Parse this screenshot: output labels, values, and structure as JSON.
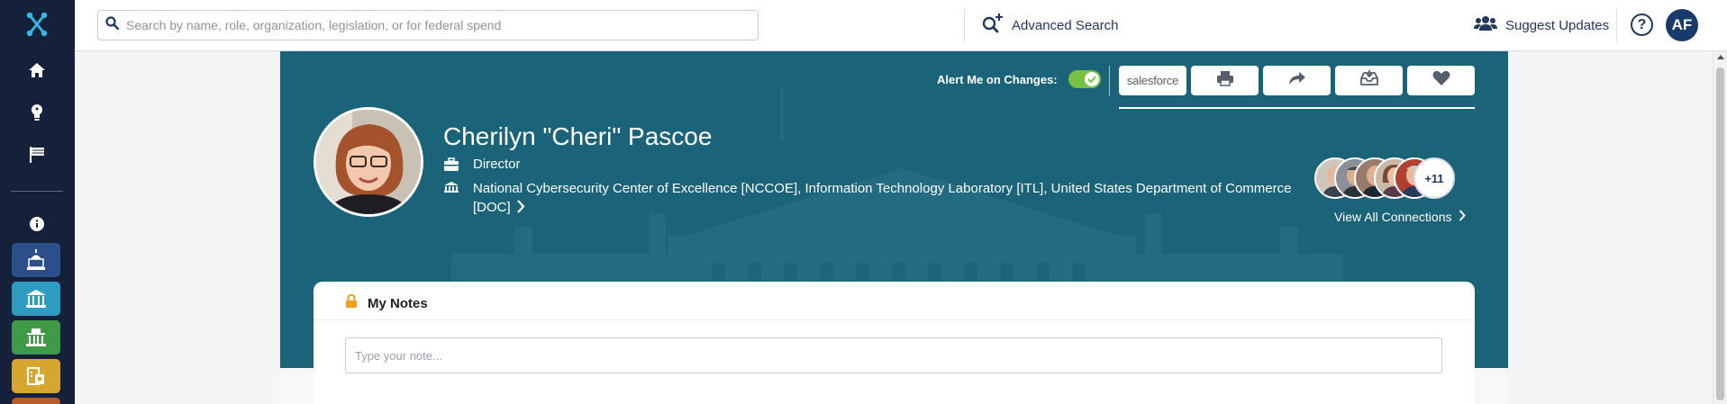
{
  "sidebar": {
    "items": [
      {
        "icon": "logo-icon"
      },
      {
        "icon": "home-icon"
      },
      {
        "icon": "lightbulb-icon"
      },
      {
        "icon": "flag-icon"
      },
      {
        "icon": "info-icon"
      },
      {
        "icon": "capitol-icon",
        "color": "#2c4f8a"
      },
      {
        "icon": "federal-building-icon",
        "color": "#2f9bbf"
      },
      {
        "icon": "state-building-icon",
        "color": "#3f9a47"
      },
      {
        "icon": "local-gov-icon",
        "color": "#d7a62f"
      }
    ]
  },
  "topbar": {
    "search_placeholder": "Search by name, role, organization, legislation, or for federal spend",
    "advanced_search": "Advanced Search",
    "suggest_updates": "Suggest Updates",
    "help": "?",
    "user_initials": "AF"
  },
  "profile": {
    "alert_label": "Alert Me on Changes:",
    "alert_enabled": true,
    "salesforce_label": "salesforce",
    "name": "Cherilyn \"Cheri\" Pascoe",
    "role": "Director",
    "organization": "National Cybersecurity Center of Excellence [NCCOE],  Information Technology Laboratory [ITL],  United States Department of Commerce [DOC]",
    "connections_more": "+11",
    "view_all_connections": "View All Connections"
  },
  "notes": {
    "title": "My Notes",
    "placeholder": "Type your note..."
  },
  "colors": {
    "sidebar": "#15203b",
    "hero": "#1a6378",
    "accent": "#79c142",
    "brand": "#22385c"
  }
}
